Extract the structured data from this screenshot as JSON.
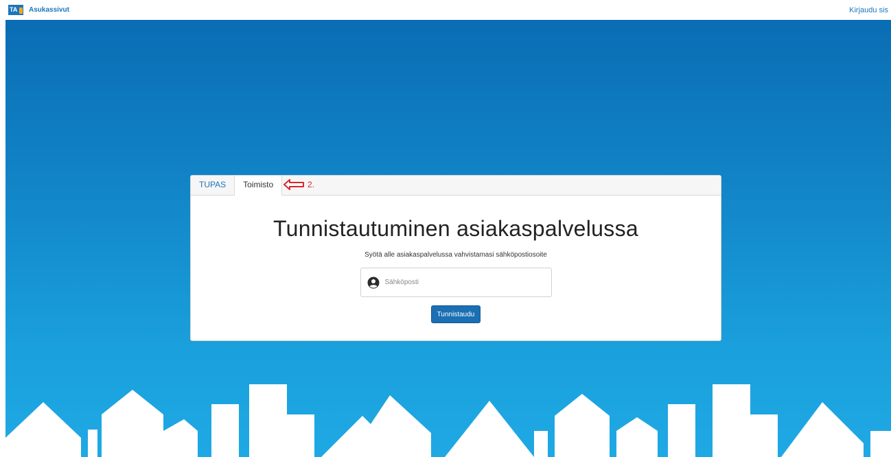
{
  "header": {
    "logo_text": "TA",
    "brand_name": "Asukassivut",
    "signin_label": "Kirjaudu sis"
  },
  "login_card": {
    "tabs": [
      {
        "label": "TUPAS",
        "active": false
      },
      {
        "label": "Toimisto",
        "active": true
      }
    ],
    "annotation": {
      "icon": "arrow-left-icon",
      "number": "2."
    },
    "title": "Tunnistautuminen asiakaspalvelussa",
    "subtitle": "Syötä alle asiakaspalvelussa vahvistamasi sähköpostiosoite",
    "email": {
      "value": "",
      "placeholder": "Sähköposti",
      "icon": "user-icon"
    },
    "submit_label": "Tunnistaudu"
  },
  "colors": {
    "brand": "#1b75bb",
    "accent": "#f5a623",
    "hero_top": "#0a6db4",
    "hero_bottom": "#1fa9e4",
    "button": "#1b6fb3",
    "annotation": "#d9262c"
  }
}
